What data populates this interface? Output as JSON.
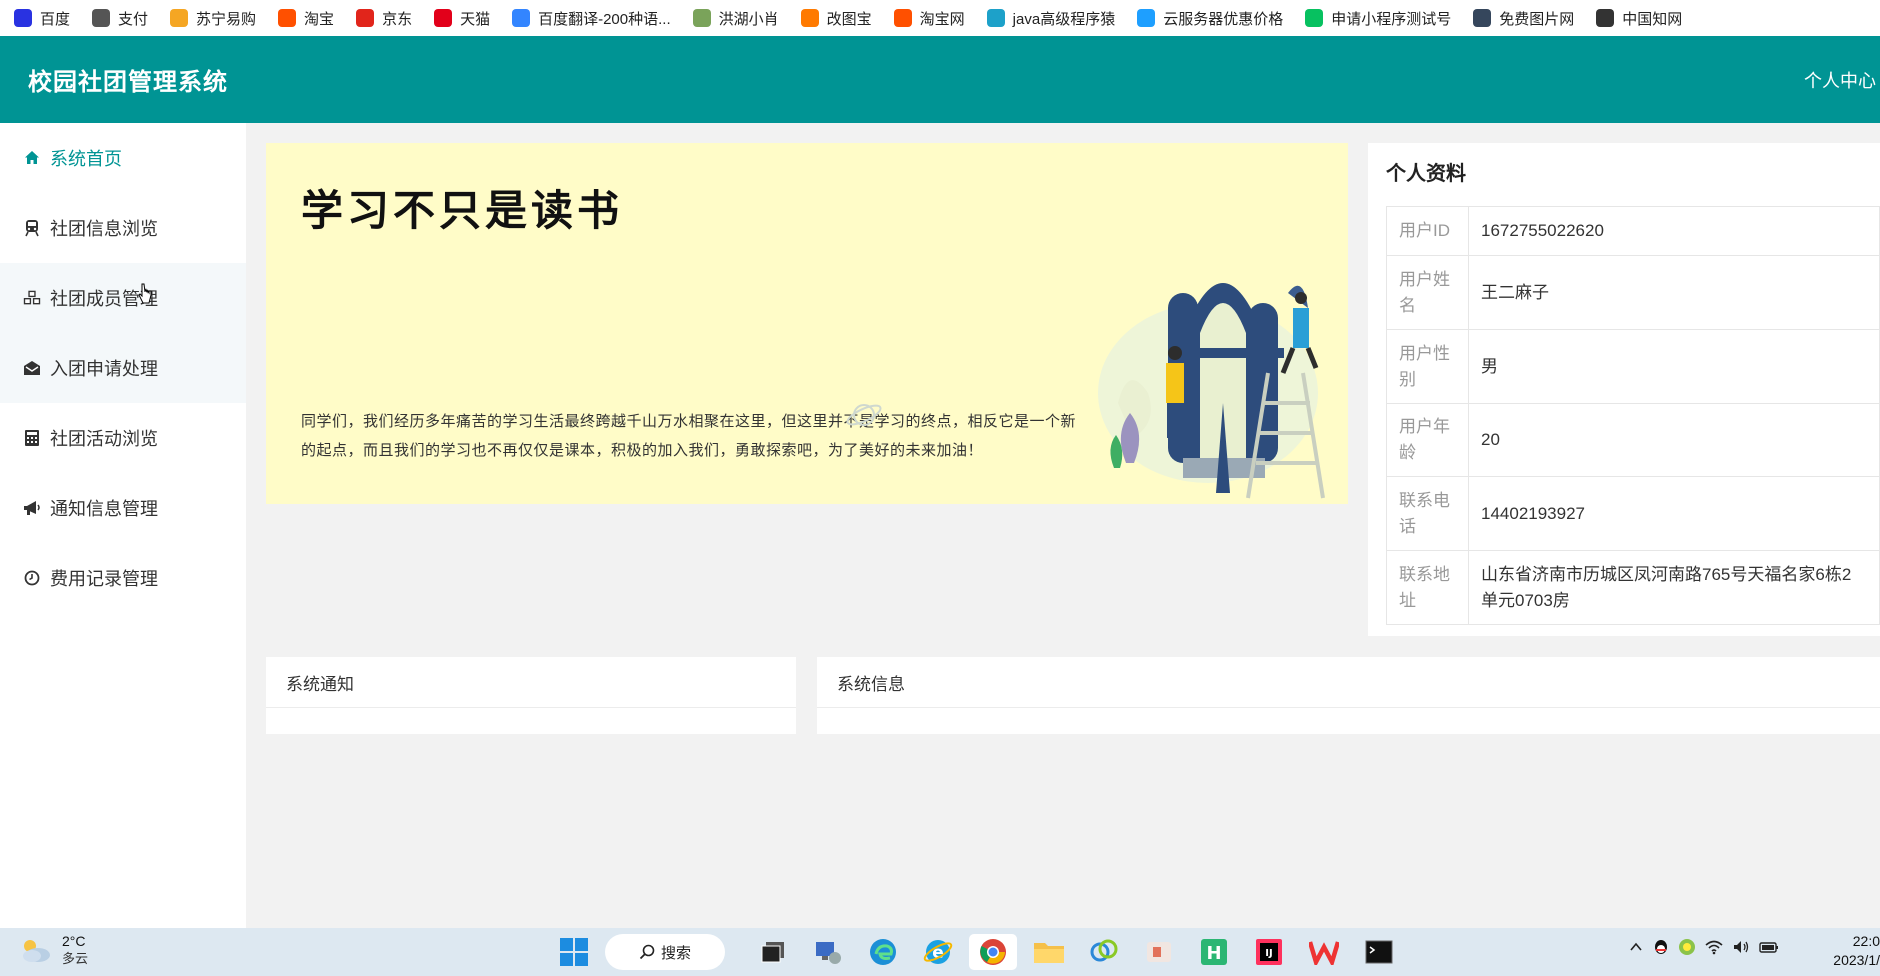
{
  "bookmarks": [
    {
      "label": "百度",
      "icon": "baidu-icon",
      "color": "#2932e1"
    },
    {
      "label": "支付",
      "icon": "globe-icon",
      "color": "#555555"
    },
    {
      "label": "苏宁易购",
      "icon": "suning-icon",
      "color": "#f5a623"
    },
    {
      "label": "淘宝",
      "icon": "taobao-icon",
      "color": "#ff5000"
    },
    {
      "label": "京东",
      "icon": "jd-icon",
      "color": "#e1251b"
    },
    {
      "label": "天猫",
      "icon": "tmall-icon",
      "color": "#e2001a"
    },
    {
      "label": "百度翻译-200种语...",
      "icon": "translate-icon",
      "color": "#3385ff"
    },
    {
      "label": "洪湖小肖",
      "icon": "bird-icon",
      "color": "#7aa35a"
    },
    {
      "label": "改图宝",
      "icon": "gaitubao-icon",
      "color": "#ff7a00"
    },
    {
      "label": "淘宝网",
      "icon": "taobao-icon",
      "color": "#ff5000"
    },
    {
      "label": "java高级程序猿",
      "icon": "bilibili-icon",
      "color": "#1da1c9"
    },
    {
      "label": "云服务器优惠价格",
      "icon": "cloud-icon",
      "color": "#1e9fff"
    },
    {
      "label": "申请小程序测试号",
      "icon": "wechat-icon",
      "color": "#07c160"
    },
    {
      "label": "免费图片网",
      "icon": "tumblr-icon",
      "color": "#35465c"
    },
    {
      "label": "中国知网",
      "icon": "cnki-icon",
      "color": "#333333"
    }
  ],
  "header": {
    "title": "校园社团管理系统",
    "user_center": "个人中心"
  },
  "sidebar": {
    "items": [
      {
        "label": "系统首页",
        "icon": "home-icon"
      },
      {
        "label": "社团信息浏览",
        "icon": "train-icon"
      },
      {
        "label": "社团成员管理",
        "icon": "cubes-icon"
      },
      {
        "label": "入团申请处理",
        "icon": "envelope-open-icon"
      },
      {
        "label": "社团活动浏览",
        "icon": "calculator-icon"
      },
      {
        "label": "通知信息管理",
        "icon": "bullhorn-icon"
      },
      {
        "label": "费用记录管理",
        "icon": "clock-icon"
      }
    ]
  },
  "banner": {
    "title": "学习不只是读书",
    "text": "同学们，我们经历多年痛苦的学习生活最终跨越千山万水相聚在这里，但这里并不是学习的终点，相反它是一个新的起点，而且我们的学习也不再仅仅是课本，积极的加入我们，勇敢探索吧，为了美好的未来加油！"
  },
  "profile": {
    "title": "个人资料",
    "rows": [
      {
        "key": "用户ID",
        "value": "1672755022620"
      },
      {
        "key": "用户姓名",
        "value": "王二麻子"
      },
      {
        "key": "用户性别",
        "value": "男"
      },
      {
        "key": "用户年龄",
        "value": "20"
      },
      {
        "key": "联系电话",
        "value": "14402193927"
      },
      {
        "key": "联系地址",
        "value": "山东省济南市历城区凤河南路765号天福名家6栋2单元0703房"
      }
    ]
  },
  "panels": {
    "notice_title": "系统通知",
    "sysinfo_title": "系统信息"
  },
  "taskbar": {
    "temperature": "2°C",
    "condition": "多云",
    "search_label": "搜索",
    "time": "22:0",
    "date": "2023/1/"
  },
  "colors": {
    "header_bg": "#009494",
    "accent": "#009494",
    "banner_bg": "#fffcc8"
  }
}
